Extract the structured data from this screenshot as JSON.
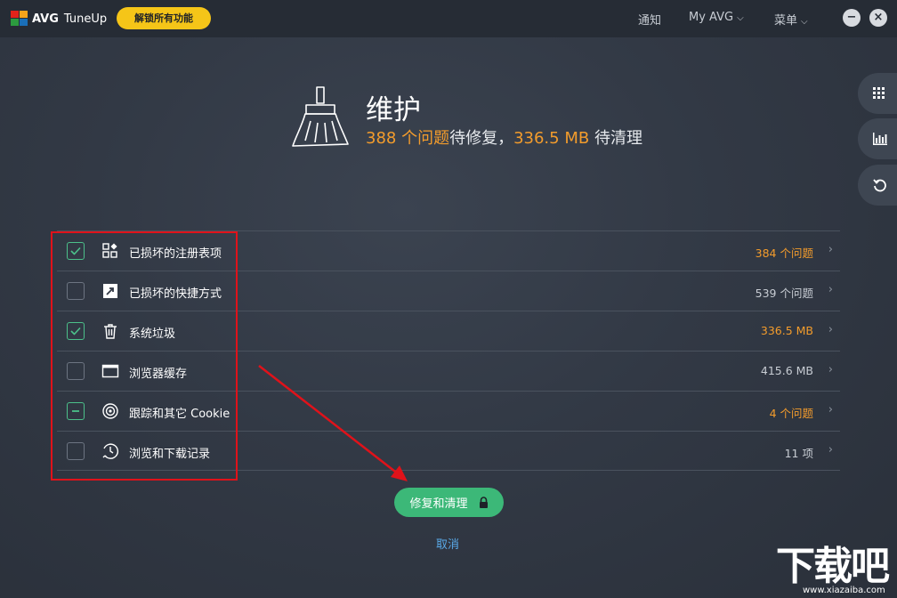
{
  "titlebar": {
    "logo_brand": "AVG",
    "logo_product": "TuneUp",
    "unlock_label": "解锁所有功能",
    "nav_notify": "通知",
    "nav_myavg": "My AVG",
    "nav_menu": "菜单",
    "minimize_label": "−",
    "close_label": "×",
    "logo_colors": [
      "#e2231a",
      "#f5a31a",
      "#2c9b3f",
      "#1a6fb8"
    ]
  },
  "side_rail": {
    "icons": [
      "apps-grid-icon",
      "stats-icon",
      "undo-icon"
    ]
  },
  "header": {
    "title": "维护",
    "issues_count": "388 个问题",
    "issues_suffix": "待修复，",
    "size_count": "336.5 MB",
    "size_suffix": " 待清理"
  },
  "items": [
    {
      "label": "已损坏的注册表项",
      "value": "384 个问题",
      "state": "checked",
      "highlight": true,
      "icon": "registry-icon"
    },
    {
      "label": "已损坏的快捷方式",
      "value": "539 个问题",
      "state": "unchecked",
      "highlight": false,
      "icon": "shortcut-icon"
    },
    {
      "label": "系统垃圾",
      "value": "336.5 MB",
      "state": "checked",
      "highlight": true,
      "icon": "trash-icon"
    },
    {
      "label": "浏览器缓存",
      "value": "415.6 MB",
      "state": "unchecked",
      "highlight": false,
      "icon": "browser-window-icon"
    },
    {
      "label": "跟踪和其它 Cookie",
      "value": "4 个问题",
      "state": "partial",
      "highlight": true,
      "icon": "tracking-icon"
    },
    {
      "label": "浏览和下载记录",
      "value": "11 项",
      "state": "unchecked",
      "highlight": false,
      "icon": "history-icon"
    }
  ],
  "actions": {
    "primary_label": "修复和清理",
    "cancel_label": "取消"
  },
  "watermark": {
    "main": "下载吧",
    "url": "www.xiazaiba.com"
  },
  "colors": {
    "accent_green": "#3cb878",
    "accent_orange": "#f39c2c",
    "annotation_red": "#e0121a",
    "link_blue": "#5aa9e8",
    "unlock_yellow": "#f5c518"
  }
}
